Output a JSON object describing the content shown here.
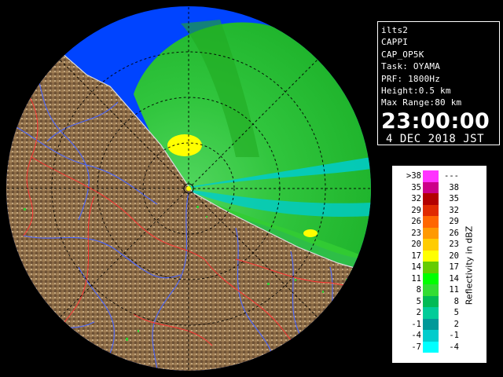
{
  "info": {
    "lines": [
      "ilts2",
      "CAPPI",
      "CAP_OP5K",
      "Task: OYAMA",
      "PRF: 1800Hz",
      "Height:0.5 km",
      "Max Range:80 km"
    ],
    "time": "23:00:00",
    "date": "4 DEC 2018 JST"
  },
  "legend": {
    "title": "Reflectivity in dBZ",
    "rows": [
      {
        "lo": ">38",
        "hi": "---",
        "color": "#ff33ff"
      },
      {
        "lo": "35",
        "hi": "38",
        "color": "#cc0088"
      },
      {
        "lo": "32",
        "hi": "35",
        "color": "#b30000"
      },
      {
        "lo": "29",
        "hi": "32",
        "color": "#e02a00"
      },
      {
        "lo": "26",
        "hi": "29",
        "color": "#ff6600"
      },
      {
        "lo": "23",
        "hi": "26",
        "color": "#ff9900"
      },
      {
        "lo": "20",
        "hi": "23",
        "color": "#ffcc00"
      },
      {
        "lo": "17",
        "hi": "20",
        "color": "#ffff00"
      },
      {
        "lo": "14",
        "hi": "17",
        "color": "#66cc00"
      },
      {
        "lo": "11",
        "hi": "14",
        "color": "#00ff00"
      },
      {
        "lo": "8",
        "hi": "11",
        "color": "#33dd33"
      },
      {
        "lo": "5",
        "hi": "8",
        "color": "#00bb55"
      },
      {
        "lo": "2",
        "hi": "5",
        "color": "#00cc99"
      },
      {
        "lo": "-1",
        "hi": "2",
        "color": "#009999"
      },
      {
        "lo": "-4",
        "hi": "-1",
        "color": "#00cccc"
      },
      {
        "lo": "-7",
        "hi": "-4",
        "color": "#00ffff"
      }
    ]
  },
  "colors": {
    "sea_background": "#0044ff",
    "land": "#8a6a45",
    "echo_green": "#22cc22",
    "echo_cyan": "#00cccc",
    "echo_yellow": "#ffff00",
    "range_ring": "#000000",
    "river": "#4a66ff",
    "boundary": "#ff3333"
  },
  "icons": {
    "radar_site": "radar-site-marker-icon"
  }
}
